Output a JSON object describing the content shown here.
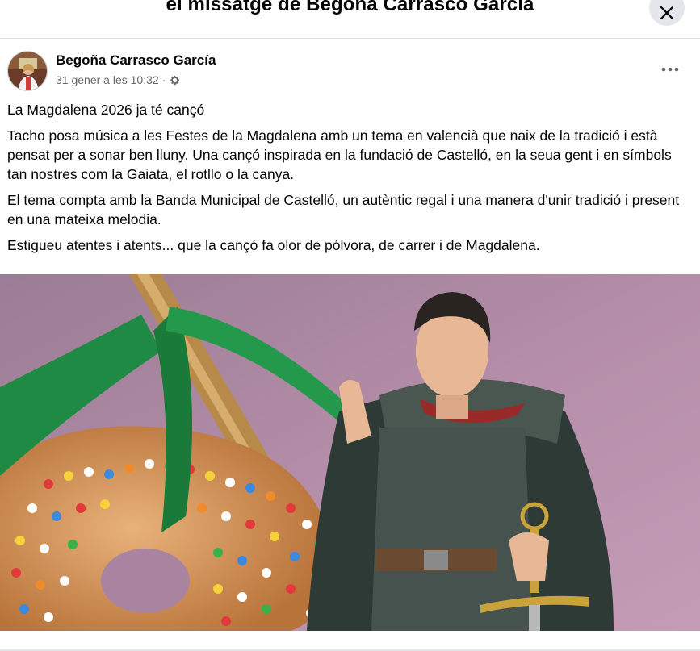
{
  "header": {
    "title": "el missatge de Begoña Carrasco García",
    "close_icon": "close-icon"
  },
  "post": {
    "author": "Begoña Carrasco García",
    "date": "31 gener a les 10:32",
    "separator": "·",
    "privacy_icon": "gear-icon",
    "more_icon": "more-horizontal-icon",
    "paragraphs": [
      "La Magdalena 2026 ja té cançó",
      "Tacho posa música a les Festes de la Magdalena amb un tema en valencià que naix de la tradició i està pensat per a sonar ben lluny. Una cançó inspirada en la fundació de Castelló, en la seua gent i en símbols tan nostres com la Gaiata, el rotllo o la canya.",
      "El tema compta amb la Banda Municipal de Castelló, un autèntic regal i una manera d'unir tradició i present en una mateixa melodia.",
      "Estigueu atentes i atents... que la cançó fa olor de pólvora, de carrer i de Magdalena."
    ]
  },
  "colors": {
    "text": "#050505",
    "secondary_text": "#65676b",
    "close_button_bg": "#e4e6eb",
    "photo_background": "#a884a0",
    "ribbon": "#1f8a43"
  }
}
